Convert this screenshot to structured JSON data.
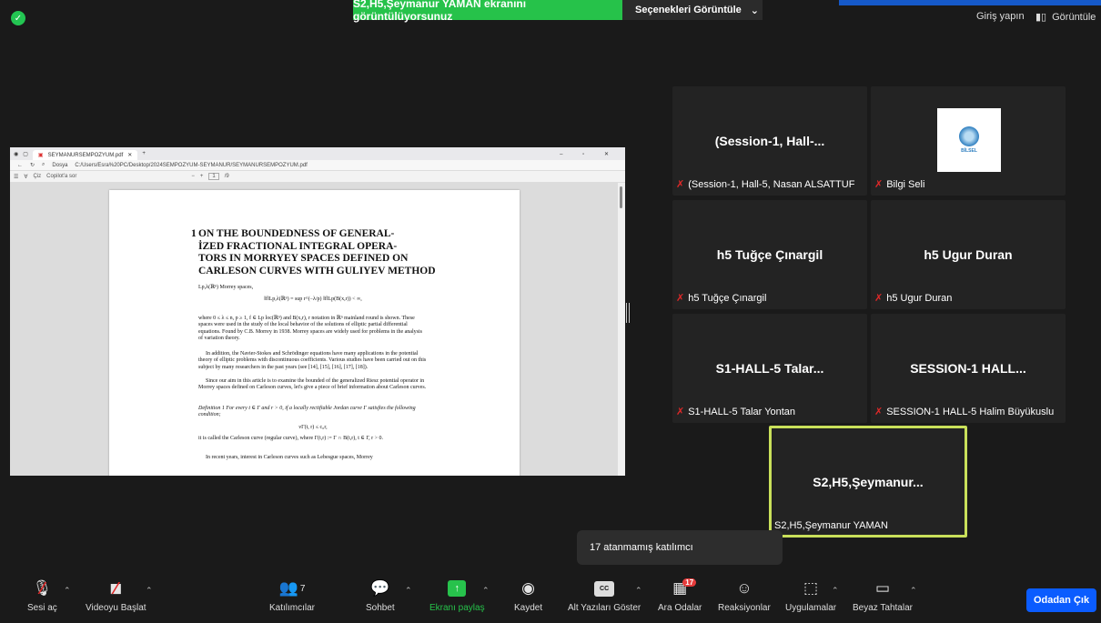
{
  "top": {
    "share_banner": "S2,H5,Şeymanur YAMAN ekranını görüntülüyorsunuz",
    "view_options": "Seçenekleri Görüntüle",
    "login": "Giriş yapın",
    "view": "Görüntüle"
  },
  "browser": {
    "tab_title": "SEYMANURSEMPOZYUM.pdf",
    "address_prefix": "Dosya",
    "address": "C:/Users/Esra%20PC/Desktop/2024SEMPOZYUM-SEYMANUR/SEYMANURSEMPOZYUM.pdf",
    "toolbar_draw": "Çiz",
    "toolbar_copilot": "Copilot'a sor",
    "page_current": "1",
    "page_total": "/9"
  },
  "pdf": {
    "section_number": "1",
    "title_lines": [
      "ON THE BOUNDEDNESS OF GENERAL-",
      "İZED FRACTIONAL INTEGRAL OPERA-",
      "TORS IN MORRYEY SPACES DEFINED ON",
      "CARLESON CURVES WITH GULIYEV METHOD"
    ],
    "line_morrey": "Lp,λ(ℝⁿ) Morrey spaces,",
    "formula_1": "‖f‖Lp,λ(ℝⁿ) = sup r^(−λ/p) ‖f‖Lp(B(x,r)) < ∞,",
    "para_1": "where 0 ≤ λ ≤ n, p ≥ 1, f ∈ Lp loc(ℝⁿ) and B(x,r), r notation in ℝⁿ mainland round is shown. These spaces were used in the study of the local behavior of the solutions of elliptic partial differential equations. Found by C.B. Morrey in 1938. Morrey spaces are widely used for problems in the analysis of variation theory.",
    "para_2": "In addition, the Navier-Stokes and Schrödinger equations have many applications in the potential theory of elliptic problems with discontinuous coefficients. Various studies have been carried out on this subject by many researchers in the past years (see [14], [15], [16], [17], [18]).",
    "para_3": "Since our aim in this article is to examine the bounded of the generalized Riesz potential operator in Morrey spaces defined on Carleson curves, let's give a piece of brief information about Carleson curves.",
    "definition": "Definition 1 For every t ∈ Γ and r > 0, if a locally rectifiable Jordan curve Γ satisfies the following condition;",
    "formula_2": "νΓ(t, r) ≤ c₀r,",
    "para_4": "it is called the Carleson curve (regular curve), where Γ(t,r) := Γ ∩ B(t,r), t ∈ Γ, r > 0.",
    "para_5": "In recent years, interest in Carleson curves such as Lebesgue spaces, Morrey"
  },
  "tiles": [
    {
      "name": "(Session-1,  Hall-...",
      "label": "(Session-1, Hall-5, Nasan ALSATTUF"
    },
    {
      "name": "",
      "label": "Bilgi Seli",
      "logo_text": "BİLSEL"
    },
    {
      "name": "h5 Tuğçe Çınargil",
      "label": "h5 Tuğçe Çınargil"
    },
    {
      "name": "h5 Ugur Duran",
      "label": "h5 Ugur Duran"
    },
    {
      "name": "S1-HALL-5  Talar...",
      "label": "S1-HALL-5 Talar Yontan"
    },
    {
      "name": "SESSION-1  HALL...",
      "label": "SESSION-1 HALL-5 Halim Büyükuslu"
    },
    {
      "name": "S2,H5,Şeymanur...",
      "label": "S2,H5,Şeymanur YAMAN"
    }
  ],
  "tooltip": "17 atanmamış katılımcı",
  "toolbar": {
    "unmute": "Sesi aç",
    "start_video": "Videoyu Başlat",
    "participants": "Katılımcılar",
    "participants_count": "7",
    "chat": "Sohbet",
    "share_screen": "Ekranı paylaş",
    "record": "Kaydet",
    "captions": "Alt Yazıları Göster",
    "breakout_rooms": "Ara Odalar",
    "breakout_count": "17",
    "reactions": "Reaksiyonlar",
    "apps": "Uygulamalar",
    "whiteboard": "Beyaz Tahtalar",
    "leave": "Odadan Çık",
    "cc": "CC"
  },
  "colors": {
    "share_green": "#26c24a",
    "leave_blue": "#0b5cff",
    "active_speaker": "#c9e05a",
    "mic_off_red": "#e02828"
  }
}
